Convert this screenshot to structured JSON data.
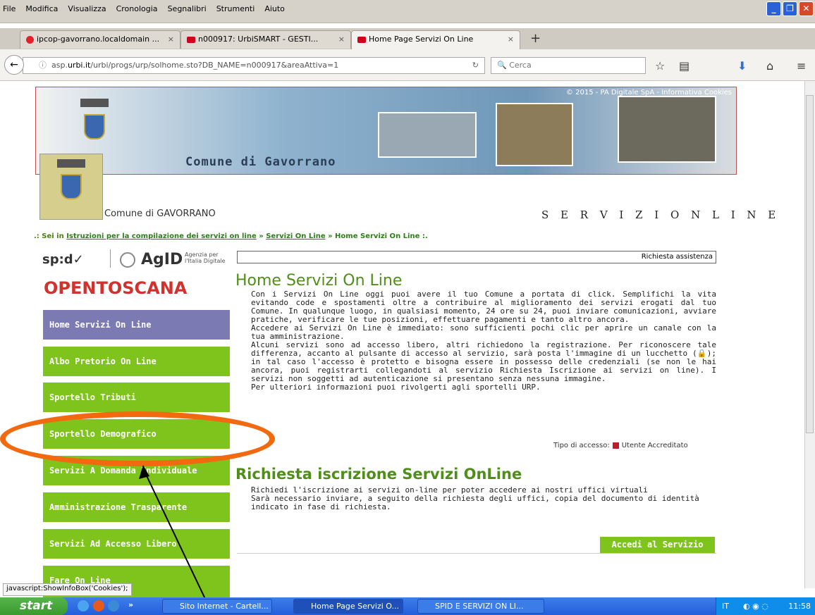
{
  "menu": [
    "File",
    "Modifica",
    "Visualizza",
    "Cronologia",
    "Segnalibri",
    "Strumenti",
    "Aiuto"
  ],
  "tabs": [
    {
      "label": "ipcop-gavorrano.localdomain ...",
      "close": "×"
    },
    {
      "label": "n000917: UrbiSMART - GESTI...",
      "close": "×"
    },
    {
      "label": "Home Page Servizi On Line",
      "close": "×"
    }
  ],
  "newtab": "+",
  "nav": {
    "url_prefix": "asp.",
    "url_domain": "urbi.it",
    "url_rest": "/urbi/progs/urp/solhome.sto?DB_NAME=n000917&areaAttiva=1",
    "search_placeholder": "Cerca"
  },
  "banner": {
    "copyright": "© 2015 - PA Digitale SpA - Informativa Cookies",
    "title": "Comune di Gavorrano"
  },
  "header": {
    "comune": "Comune di GAVORRANO",
    "servizi": "S E R V I Z I   O N   L I N E"
  },
  "breadcrumb": {
    "lead": ".: Sei in ",
    "link1": "Istruzioni per la compilazione dei servizi on line",
    "sep1": " » ",
    "link2": "Servizi On Line",
    "sep2": " » ",
    "current": "Home Servizi On Line :."
  },
  "logos": {
    "spid": "sp:d✓",
    "agid": "AgID",
    "agid_sub1": "Agenzia per",
    "agid_sub2": "l'Italia Digitale",
    "opentoscana": "OPENTOSCANA"
  },
  "sidebar": [
    {
      "label": "Home Servizi On Line",
      "active": true
    },
    {
      "label": "Albo Pretorio On Line"
    },
    {
      "label": "Sportello Tributi"
    },
    {
      "label": "Sportello Demografico"
    },
    {
      "label": "Servizi A Domanda Individuale"
    },
    {
      "label": "Amministrazione Trasparente"
    },
    {
      "label": "Servizi Ad Accesso Libero"
    },
    {
      "label": "Fare On Line"
    }
  ],
  "main": {
    "assist": "Richiesta assistenza",
    "title": "Home Servizi On Line",
    "intro": [
      "Con i Servizi On Line oggi puoi avere il tuo Comune a portata di click. Semplifichi la vita evitando code e spostamenti oltre a contribuire al miglioramento dei servizi erogati dal tuo Comune. In qualunque luogo, in qualsiasi momento, 24 ore su 24, puoi inviare comunicazioni, avviare pratiche, verificare le tue posizioni, effettuare pagamenti e tanto altro ancora.",
      "Accedere ai Servizi On Line è immediato: sono sufficienti pochi clic per aprire un canale con la tua amministrazione.",
      "Alcuni servizi sono ad accesso libero, altri richiedono la registrazione. Per riconoscere tale differenza, accanto al pulsante di accesso al servizio, sarà posta l'immagine di un lucchetto (🔒); in tal caso l'accesso è protetto e bisogna essere in possesso delle credenziali (se non le hai ancora, puoi registrarti collegandoti al servizio Richiesta Iscrizione ai servizi on line). I servizi non soggetti ad autenticazione si presentano senza nessuna immagine.",
      "Per ulteriori informazioni puoi rivolgerti agli sportelli URP."
    ],
    "tipo_label": "Tipo di accesso:",
    "tipo_value": "Utente Accreditato",
    "section_title": "Richiesta iscrizione Servizi OnLine",
    "section_text": [
      "Richiedi l'iscrizione ai servizi on-line per poter accedere ai nostri uffici virtuali",
      "Sarà necessario inviare, a seguito della richiesta degli uffici, copia del documento di identità indicato in fase di richiesta."
    ],
    "accedi": "Accedi al Servizio"
  },
  "status": "javascript:ShowInfoBox('Cookies');",
  "taskbar": {
    "start": "start",
    "chevron": "»",
    "items": [
      "Sito Internet - Cartell...",
      "Home Page Servizi O...",
      "SPID E SERVIZI ON LI..."
    ],
    "lang": "IT",
    "time": "11:58"
  },
  "colors": {
    "green": "#7fc31d",
    "purple": "#7b7ab2",
    "annotation": "#f26a10"
  }
}
